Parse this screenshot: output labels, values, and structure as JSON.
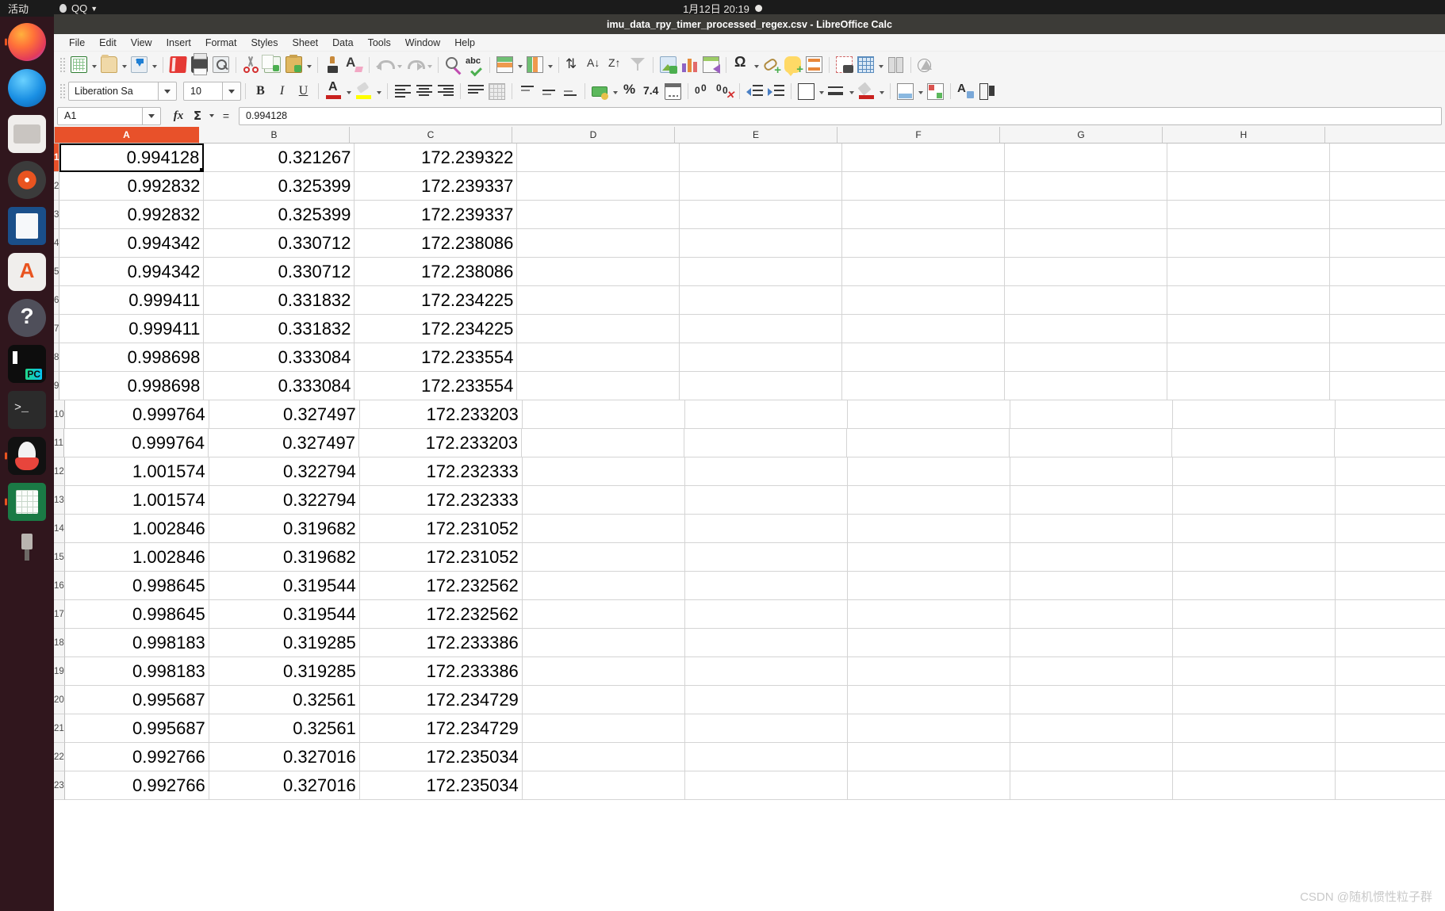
{
  "system_bar": {
    "activities": "活动",
    "app_indicator": "QQ",
    "clock": "1月12日 20:19"
  },
  "dock": {
    "items": [
      {
        "name": "firefox",
        "label": "Firefox"
      },
      {
        "name": "thunderbird",
        "label": "Thunderbird Mail"
      },
      {
        "name": "files",
        "label": "Files"
      },
      {
        "name": "rhythmbox",
        "label": "Rhythmbox"
      },
      {
        "name": "libreoffice-writer",
        "label": "LibreOffice Writer"
      },
      {
        "name": "ubuntu-software",
        "label": "Ubuntu Software"
      },
      {
        "name": "help",
        "label": "Help"
      },
      {
        "name": "pycharm",
        "label": "PyCharm"
      },
      {
        "name": "terminal",
        "label": "Terminal"
      },
      {
        "name": "qq",
        "label": "QQ"
      },
      {
        "name": "libreoffice-calc",
        "label": "LibreOffice Calc"
      },
      {
        "name": "usb-drive",
        "label": "USB Drive"
      }
    ]
  },
  "window": {
    "title": "imu_data_rpy_timer_processed_regex.csv - LibreOffice Calc"
  },
  "menubar": {
    "items": [
      {
        "label": "File"
      },
      {
        "label": "Edit"
      },
      {
        "label": "View"
      },
      {
        "label": "Insert"
      },
      {
        "label": "Format"
      },
      {
        "label": "Styles"
      },
      {
        "label": "Sheet"
      },
      {
        "label": "Data"
      },
      {
        "label": "Tools"
      },
      {
        "label": "Window"
      },
      {
        "label": "Help"
      }
    ]
  },
  "standard_toolbar": {
    "buttons": [
      {
        "name": "new-document",
        "label": "New"
      },
      {
        "name": "open-document",
        "label": "Open"
      },
      {
        "name": "save-document",
        "label": "Save"
      },
      {
        "name": "export-pdf",
        "label": "Export as PDF"
      },
      {
        "name": "print",
        "label": "Print"
      },
      {
        "name": "print-preview",
        "label": "Toggle Print Preview"
      },
      {
        "name": "cut",
        "label": "Cut"
      },
      {
        "name": "copy",
        "label": "Copy"
      },
      {
        "name": "paste",
        "label": "Paste"
      },
      {
        "name": "clone-formatting",
        "label": "Clone Formatting"
      },
      {
        "name": "clear-formatting",
        "label": "Clear Direct Formatting"
      },
      {
        "name": "undo",
        "label": "Undo"
      },
      {
        "name": "redo",
        "label": "Redo"
      },
      {
        "name": "find-and-replace",
        "label": "Find and Replace"
      },
      {
        "name": "spelling",
        "label": "Spelling"
      },
      {
        "name": "row",
        "label": "Row"
      },
      {
        "name": "column",
        "label": "Column"
      },
      {
        "name": "sort",
        "label": "Sort"
      },
      {
        "name": "sort-ascending",
        "label": "Sort Ascending"
      },
      {
        "name": "sort-descending",
        "label": "Sort Descending"
      },
      {
        "name": "autofilter",
        "label": "AutoFilter"
      },
      {
        "name": "insert-image",
        "label": "Insert Image"
      },
      {
        "name": "insert-chart",
        "label": "Insert Chart"
      },
      {
        "name": "pivot-table",
        "label": "Insert or Edit Pivot Table"
      },
      {
        "name": "special-character",
        "label": "Insert Special Character"
      },
      {
        "name": "insert-hyperlink",
        "label": "Insert Hyperlink"
      },
      {
        "name": "insert-comment",
        "label": "Insert Comment"
      },
      {
        "name": "headers-and-footers",
        "label": "Headers and Footers"
      },
      {
        "name": "define-print-area",
        "label": "Define Print Area"
      },
      {
        "name": "freeze-rows-columns",
        "label": "Freeze Rows and Columns"
      },
      {
        "name": "split-window",
        "label": "Split Window"
      },
      {
        "name": "show-draw-functions",
        "label": "Show Draw Functions"
      }
    ]
  },
  "formatting_toolbar": {
    "font_name": "Liberation Sa",
    "font_size": "10",
    "buttons": [
      {
        "name": "bold",
        "label": "B"
      },
      {
        "name": "italic",
        "label": "I"
      },
      {
        "name": "underline",
        "label": "U"
      },
      {
        "name": "font-color",
        "label": "Font Color"
      },
      {
        "name": "highlighting-color",
        "label": "Highlighting Color"
      },
      {
        "name": "align-left",
        "label": "Align Left"
      },
      {
        "name": "align-center",
        "label": "Align Center"
      },
      {
        "name": "align-right",
        "label": "Align Right"
      },
      {
        "name": "wrap-text",
        "label": "Wrap Text"
      },
      {
        "name": "merge-cells",
        "label": "Merge Cells"
      },
      {
        "name": "align-top",
        "label": "Align Top"
      },
      {
        "name": "center-vertically",
        "label": "Center Vertically"
      },
      {
        "name": "align-bottom",
        "label": "Align Bottom"
      },
      {
        "name": "format-as-currency",
        "label": "Format as Currency"
      },
      {
        "name": "format-as-percent",
        "label": "Format as Percent"
      },
      {
        "name": "format-as-number",
        "label": "Format as Number"
      },
      {
        "name": "format-as-date",
        "label": "Format as Date"
      },
      {
        "name": "add-decimal-place",
        "label": "Add Decimal Place"
      },
      {
        "name": "delete-decimal-place",
        "label": "Delete Decimal Place"
      },
      {
        "name": "increase-indent",
        "label": "Increase Indent"
      },
      {
        "name": "decrease-indent",
        "label": "Decrease Indent"
      },
      {
        "name": "borders",
        "label": "Borders"
      },
      {
        "name": "border-style",
        "label": "Border Style"
      },
      {
        "name": "border-color",
        "label": "Border Color"
      },
      {
        "name": "background-color",
        "label": "Background Color"
      },
      {
        "name": "conditional-formatting",
        "label": "Conditional Formatting"
      },
      {
        "name": "styles",
        "label": "Styles"
      },
      {
        "name": "sidebar-settings",
        "label": "Sidebar Settings"
      }
    ]
  },
  "formula_bar": {
    "name_box": "A1",
    "function_wizard": "fx",
    "sum": "Σ",
    "equals": "=",
    "input_line": "0.994128"
  },
  "sheet": {
    "columns": [
      "A",
      "B",
      "C",
      "D",
      "E",
      "F",
      "G",
      "H"
    ],
    "selected_column": "A",
    "active_cell": "A1",
    "rows": [
      {
        "num": "1",
        "cells": [
          "0.994128",
          "0.321267",
          "172.239322",
          "",
          "",
          "",
          "",
          ""
        ]
      },
      {
        "num": "2",
        "cells": [
          "0.992832",
          "0.325399",
          "172.239337",
          "",
          "",
          "",
          "",
          ""
        ]
      },
      {
        "num": "3",
        "cells": [
          "0.992832",
          "0.325399",
          "172.239337",
          "",
          "",
          "",
          "",
          ""
        ]
      },
      {
        "num": "4",
        "cells": [
          "0.994342",
          "0.330712",
          "172.238086",
          "",
          "",
          "",
          "",
          ""
        ]
      },
      {
        "num": "5",
        "cells": [
          "0.994342",
          "0.330712",
          "172.238086",
          "",
          "",
          "",
          "",
          ""
        ]
      },
      {
        "num": "6",
        "cells": [
          "0.999411",
          "0.331832",
          "172.234225",
          "",
          "",
          "",
          "",
          ""
        ]
      },
      {
        "num": "7",
        "cells": [
          "0.999411",
          "0.331832",
          "172.234225",
          "",
          "",
          "",
          "",
          ""
        ]
      },
      {
        "num": "8",
        "cells": [
          "0.998698",
          "0.333084",
          "172.233554",
          "",
          "",
          "",
          "",
          ""
        ]
      },
      {
        "num": "9",
        "cells": [
          "0.998698",
          "0.333084",
          "172.233554",
          "",
          "",
          "",
          "",
          ""
        ]
      },
      {
        "num": "10",
        "cells": [
          "0.999764",
          "0.327497",
          "172.233203",
          "",
          "",
          "",
          "",
          ""
        ]
      },
      {
        "num": "11",
        "cells": [
          "0.999764",
          "0.327497",
          "172.233203",
          "",
          "",
          "",
          "",
          ""
        ]
      },
      {
        "num": "12",
        "cells": [
          "1.001574",
          "0.322794",
          "172.232333",
          "",
          "",
          "",
          "",
          ""
        ]
      },
      {
        "num": "13",
        "cells": [
          "1.001574",
          "0.322794",
          "172.232333",
          "",
          "",
          "",
          "",
          ""
        ]
      },
      {
        "num": "14",
        "cells": [
          "1.002846",
          "0.319682",
          "172.231052",
          "",
          "",
          "",
          "",
          ""
        ]
      },
      {
        "num": "15",
        "cells": [
          "1.002846",
          "0.319682",
          "172.231052",
          "",
          "",
          "",
          "",
          ""
        ]
      },
      {
        "num": "16",
        "cells": [
          "0.998645",
          "0.319544",
          "172.232562",
          "",
          "",
          "",
          "",
          ""
        ]
      },
      {
        "num": "17",
        "cells": [
          "0.998645",
          "0.319544",
          "172.232562",
          "",
          "",
          "",
          "",
          ""
        ]
      },
      {
        "num": "18",
        "cells": [
          "0.998183",
          "0.319285",
          "172.233386",
          "",
          "",
          "",
          "",
          ""
        ]
      },
      {
        "num": "19",
        "cells": [
          "0.998183",
          "0.319285",
          "172.233386",
          "",
          "",
          "",
          "",
          ""
        ]
      },
      {
        "num": "20",
        "cells": [
          "0.995687",
          "0.32561",
          "172.234729",
          "",
          "",
          "",
          "",
          ""
        ]
      },
      {
        "num": "21",
        "cells": [
          "0.995687",
          "0.32561",
          "172.234729",
          "",
          "",
          "",
          "",
          ""
        ]
      },
      {
        "num": "22",
        "cells": [
          "0.992766",
          "0.327016",
          "172.235034",
          "",
          "",
          "",
          "",
          ""
        ]
      },
      {
        "num": "23",
        "cells": [
          "0.992766",
          "0.327016",
          "172.235034",
          "",
          "",
          "",
          "",
          ""
        ]
      }
    ]
  },
  "watermark": {
    "text": "CSDN @随机惯性粒子群"
  },
  "colors": {
    "accent": "#e8512a",
    "titlebar": "#3c3b37",
    "toolbar_bg": "#f5f5f5",
    "dock_bg": "#2c0b15"
  }
}
